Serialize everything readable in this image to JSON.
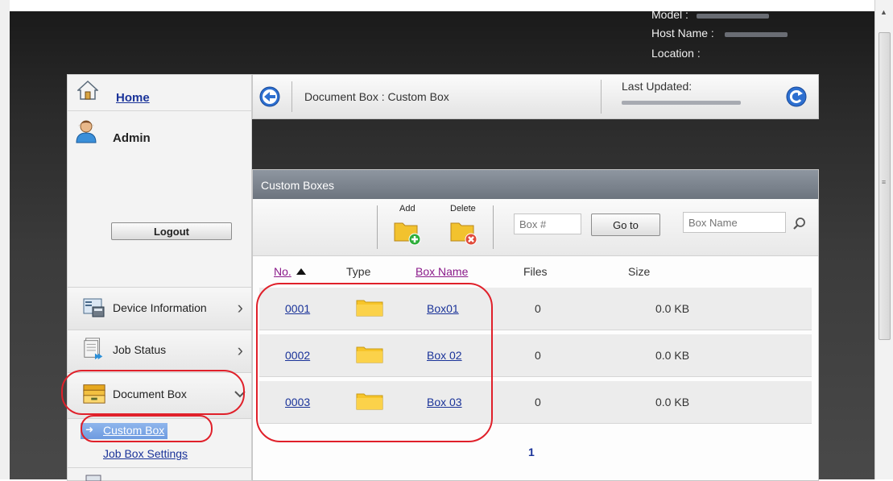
{
  "device_info": {
    "model_label": "Model :",
    "host_label": "Host Name :",
    "location_label": "Location :"
  },
  "sidebar": {
    "home_label": "Home",
    "user_label": "Admin",
    "logout_label": "Logout",
    "menu": [
      {
        "label": "Device Information",
        "icon": "device-information-icon"
      },
      {
        "label": "Job Status",
        "icon": "job-status-icon"
      },
      {
        "label": "Document Box",
        "icon": "document-box-icon"
      }
    ],
    "submenu": [
      {
        "label": "Custom Box"
      },
      {
        "label": "Job Box Settings"
      }
    ]
  },
  "breadcrumb": {
    "path": "Document Box : Custom Box",
    "last_updated_label": "Last Updated:"
  },
  "panel": {
    "title": "Custom Boxes",
    "add_label": "Add",
    "delete_label": "Delete",
    "box_number_placeholder": "Box #",
    "goto_label": "Go to",
    "box_name_placeholder": "Box Name",
    "columns": {
      "no": "No.",
      "type": "Type",
      "box_name": "Box Name",
      "files": "Files",
      "size": "Size"
    },
    "rows": [
      {
        "no": "0001",
        "box_name": "Box01",
        "files": "0",
        "size": "0.0 KB"
      },
      {
        "no": "0002",
        "box_name": "Box 02",
        "files": "0",
        "size": "0.0 KB"
      },
      {
        "no": "0003",
        "box_name": "Box 03",
        "files": "0",
        "size": "0.0 KB"
      }
    ],
    "page_number": "1"
  },
  "colors": {
    "annotation": "#e0202a",
    "link": "#1a3399",
    "visited_link": "#8a1a8a",
    "header_gray": "#7c848e"
  }
}
